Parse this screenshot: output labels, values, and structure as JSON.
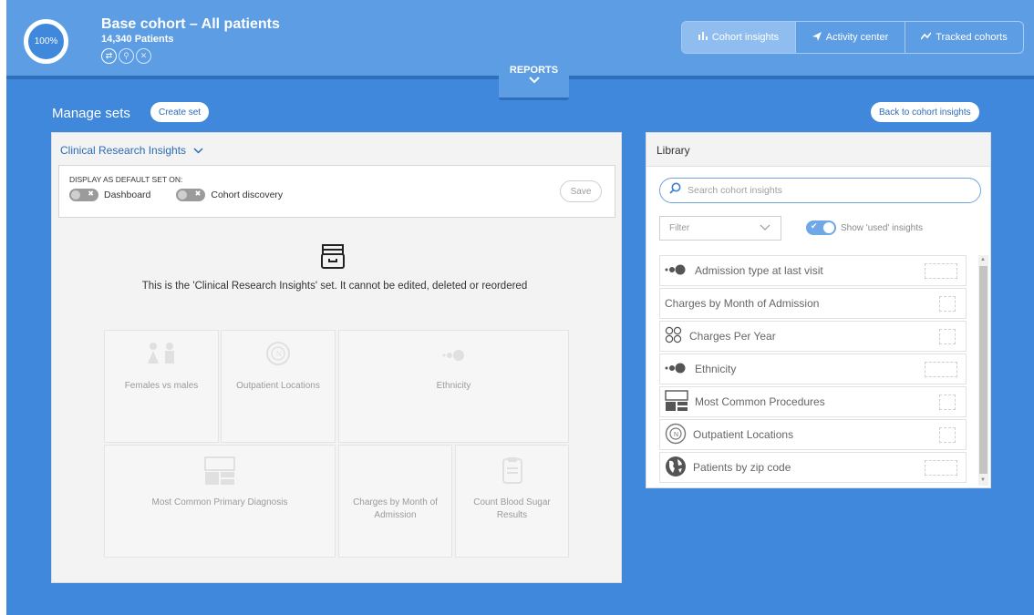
{
  "header": {
    "progress": "100%",
    "cohort_title": "Base cohort – All patients",
    "cohort_count": "14,340 Patients",
    "cohort_icons": [
      "swap-icon",
      "pin-icon",
      "close-icon"
    ],
    "tabs": [
      {
        "label": "Cohort insights",
        "icon": "bar-chart-icon",
        "active": true
      },
      {
        "label": "Activity center",
        "icon": "send-icon",
        "active": false
      },
      {
        "label": "Tracked cohorts",
        "icon": "trend-icon",
        "active": false
      }
    ],
    "reports_label": "REPORTS"
  },
  "manage": {
    "title": "Manage sets",
    "create_label": "Create set",
    "back_label": "Back to cohort insights"
  },
  "set_panel": {
    "title": "Clinical Research Insights",
    "default_label": "DISPLAY AS DEFAULT SET ON:",
    "toggle_dashboard": "Dashboard",
    "toggle_discovery": "Cohort discovery",
    "save_label": "Save",
    "message": "This is the 'Clinical Research Insights' set. It cannot be edited, deleted or reordered",
    "cards": [
      {
        "label": "Females vs males",
        "icon": "gender-icon"
      },
      {
        "label": "Outpatient Locations",
        "icon": "compass-icon"
      },
      {
        "label": "Ethnicity",
        "icon": "ethnicity-icon"
      },
      {
        "label": "Most Common Primary Diagnosis",
        "icon": "layout-icon"
      },
      {
        "label": "Charges by Month of Admission",
        "icon": "none"
      },
      {
        "label": "Count Blood Sugar Results",
        "icon": "clipboard-icon"
      }
    ]
  },
  "library": {
    "title": "Library",
    "search_placeholder": "Search cohort insights",
    "filter_label": "Filter",
    "show_used_label": "Show 'used' insights",
    "items": [
      {
        "label": "Admission type at last visit",
        "icon": "ethnicity-icon"
      },
      {
        "label": "Charges by Month of Admission",
        "icon": "none"
      },
      {
        "label": "Charges Per Year",
        "icon": "clocks-icon"
      },
      {
        "label": "Ethnicity",
        "icon": "ethnicity-icon"
      },
      {
        "label": "Most Common Procedures",
        "icon": "layout-icon"
      },
      {
        "label": "Outpatient Locations",
        "icon": "compass-icon"
      },
      {
        "label": "Patients by zip code",
        "icon": "globe-icon"
      }
    ]
  }
}
